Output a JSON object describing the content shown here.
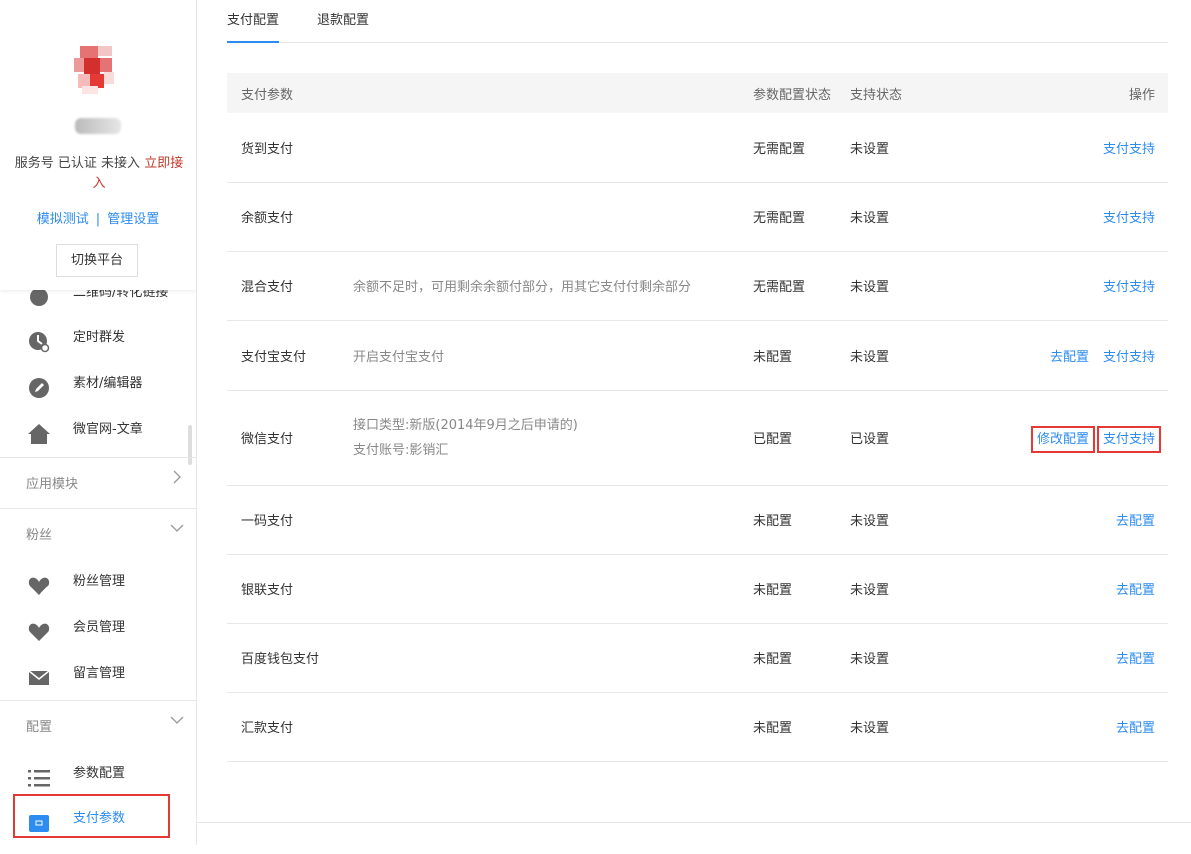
{
  "profile": {
    "account_status_prefix": "服务号 已认证 未接入",
    "account_status_link": "立即接入",
    "simulate_test": "模拟测试",
    "separator": "|",
    "manage_settings": "管理设置",
    "switch_platform": "切换平台"
  },
  "sidebar": {
    "partial_item": "二维码/转化链接",
    "items_top": [
      {
        "label": "定时群发",
        "icon": "clock-icon"
      },
      {
        "label": "素材/编辑器",
        "icon": "pencil-icon"
      },
      {
        "label": "微官网-文章",
        "icon": "home-icon"
      }
    ],
    "groups": {
      "apps": "应用模块",
      "fans": "粉丝",
      "config": "配置"
    },
    "fans_items": [
      {
        "label": "粉丝管理",
        "icon": "heart-icon"
      },
      {
        "label": "会员管理",
        "icon": "heart-icon"
      },
      {
        "label": "留言管理",
        "icon": "mail-icon"
      }
    ],
    "config_items": [
      {
        "label": "参数配置",
        "icon": "list-icon"
      },
      {
        "label": "支付参数",
        "icon": "wallet-icon"
      }
    ],
    "active_color": "#2d8cf0"
  },
  "tabs": [
    {
      "label": "支付配置",
      "active": true
    },
    {
      "label": "退款配置",
      "active": false
    }
  ],
  "table": {
    "headers": {
      "name": "支付参数",
      "config_status": "参数配置状态",
      "support_status": "支持状态",
      "operation": "操作"
    },
    "rows": [
      {
        "name": "货到支付",
        "desc": "",
        "config": "无需配置",
        "support": "未设置",
        "ops": [
          "支付支持"
        ]
      },
      {
        "name": "余额支付",
        "desc": "",
        "config": "无需配置",
        "support": "未设置",
        "ops": [
          "支付支持"
        ]
      },
      {
        "name": "混合支付",
        "desc": "余额不足时，可用剩余余额付部分，用其它支付付剩余部分",
        "config": "无需配置",
        "support": "未设置",
        "ops": [
          "支付支持"
        ]
      },
      {
        "name": "支付宝支付",
        "desc": "开启支付宝支付",
        "config": "未配置",
        "support": "未设置",
        "ops": [
          "去配置",
          "支付支持"
        ]
      },
      {
        "name": "微信支付",
        "desc": "接口类型:新版(2014年9月之后申请的)",
        "desc2": "支付账号:影销汇",
        "config": "已配置",
        "support": "已设置",
        "ops": [
          "修改配置",
          "支付支持"
        ]
      },
      {
        "name": "一码支付",
        "desc": "",
        "config": "未配置",
        "support": "未设置",
        "ops": [
          "去配置"
        ]
      },
      {
        "name": "银联支付",
        "desc": "",
        "config": "未配置",
        "support": "未设置",
        "ops": [
          "去配置"
        ]
      },
      {
        "name": "百度钱包支付",
        "desc": "",
        "config": "未配置",
        "support": "未设置",
        "ops": [
          "去配置"
        ]
      },
      {
        "name": "汇款支付",
        "desc": "",
        "config": "未配置",
        "support": "未设置",
        "ops": [
          "去配置"
        ]
      }
    ]
  },
  "colors": {
    "link": "#2d8cf0",
    "highlight": "#e53935"
  }
}
